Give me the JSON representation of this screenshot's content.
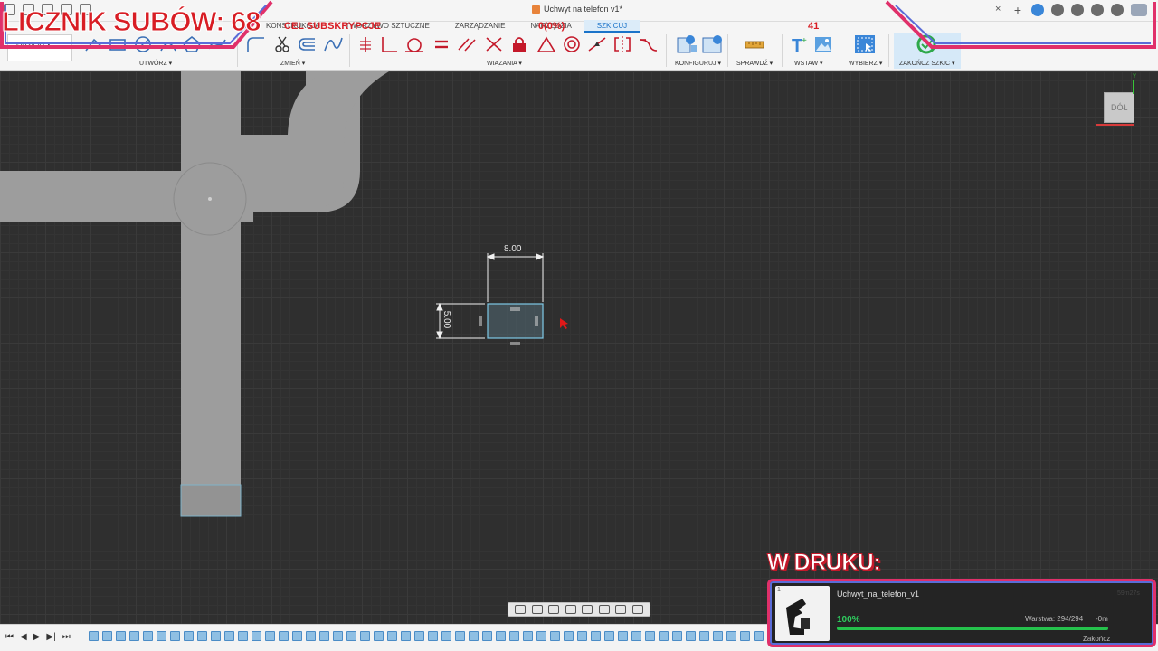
{
  "window": {
    "doc_title": "Uchwyt na telefon v1*",
    "close_glyph": "×"
  },
  "tabs": [
    {
      "label": "KONSTRUKCJA"
    },
    {
      "label": "TWORZYWO SZTUCZNE"
    },
    {
      "label": "ZARZĄDZANIE"
    },
    {
      "label": "NARZĘDZIA"
    },
    {
      "label": "SZKICUJ",
      "active": true
    }
  ],
  "ribbon": {
    "workspace": "PROJEKT ▾",
    "groups": {
      "create": "UTWÓRZ ▾",
      "modify": "ZMIEŃ ▾",
      "constraints": "WIĄZANIA ▾",
      "configure": "KONFIGURUJ ▾",
      "inspect": "SPRAWDŹ ▾",
      "insert": "WSTAW ▾",
      "select": "WYBIERZ ▾",
      "finish": "ZAKOŃCZ SZKIC ▾"
    }
  },
  "sketch": {
    "dim_width": "8.00",
    "dim_height": "5.00"
  },
  "view_cube": {
    "face_label": "DÓŁ",
    "axis_y": "Y"
  },
  "timeline": {
    "controls": [
      "⏮",
      "◀",
      "▶",
      "▶|",
      "⏭"
    ],
    "item_count": 60
  },
  "overlay": {
    "sub_counter": "LICZNIK SUBÓW: 68",
    "sub_goal_label": "CEL SUBSKRYPCJE",
    "sub_goal_progress": "0(0%)",
    "sub_goal_target": "41",
    "print_heading": "W DRUKU:",
    "print_index": "1",
    "print_name": "Uchwyt_na_telefon_v1",
    "print_time": "59m27s",
    "print_percent": "100%",
    "print_progress": 1.0,
    "print_layer": "Warstwa: 294/294",
    "print_remaining": "-0m",
    "print_finish": "Zakończ"
  },
  "colors": {
    "accent": "#1a73c9",
    "overlay_red": "#d81d24",
    "frame_pink": "#e0306a",
    "frame_blue": "#5a6cd8",
    "progress_green": "#25c24c"
  }
}
